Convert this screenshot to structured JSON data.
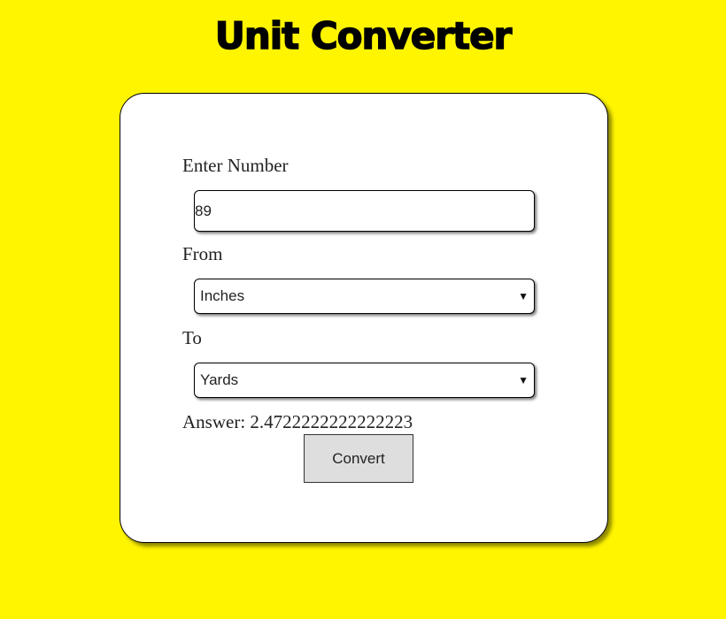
{
  "app": {
    "title": "Unit Converter"
  },
  "form": {
    "number_label": "Enter Number",
    "number_value": "89",
    "from_label": "From",
    "from_value": "Inches",
    "to_label": "To",
    "to_value": "Yards",
    "answer_text": "Answer: 2.4722222222222223",
    "convert_label": "Convert"
  },
  "icons": {
    "dropdown_arrow": "▼"
  },
  "colors": {
    "background": "#fff500",
    "card": "#ffffff",
    "button": "#dedede"
  }
}
